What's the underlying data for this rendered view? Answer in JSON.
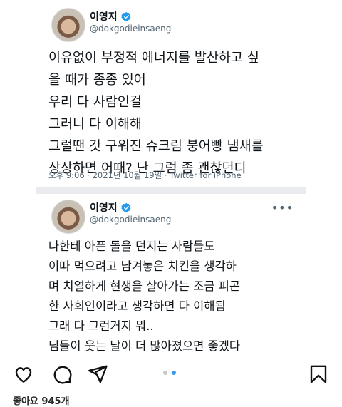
{
  "tweet1": {
    "name": "이영지",
    "handle": "@dokgodieinsaeng",
    "lines": [
      "이유없이 부정적 에너지를 발산하고 싶",
      "을 때가 종종 있어",
      "우리 다 사람인걸",
      "그러니 다 이해해",
      "그럴땐 갓 구워진 슈크림 붕어빵 냄새를",
      "상상하면 어때? 난 그럼 좀 괜찮던디"
    ],
    "time": "오후 9:06",
    "date": "2021년 10월 19일",
    "source": "Twitter for iPhone"
  },
  "tweet2": {
    "name": "이영지",
    "handle": "@dokgodieinsaeng",
    "lines": [
      "나한테 아픈 돌을 던지는 사람들도",
      "이따 먹으려고 남겨놓은 치킨을 생각하",
      "며 치열하게 현생을 살아가는 조금 피곤",
      "한 사회인이라고 생각하면 다 이해됨",
      "그래 다 그런거지 뭐..",
      "님들이 웃는 날이 더 많아졌으면 좋겠다"
    ]
  },
  "post": {
    "likes_text": "좋아요 945개",
    "carousel_index": 2,
    "carousel_total": 2
  },
  "colors": {
    "verified": "#1d9bf0",
    "carousel_active": "#3897f0"
  },
  "icons": [
    "heart-icon",
    "comment-icon",
    "share-icon",
    "bookmark-icon",
    "verified-icon",
    "more-icon"
  ]
}
